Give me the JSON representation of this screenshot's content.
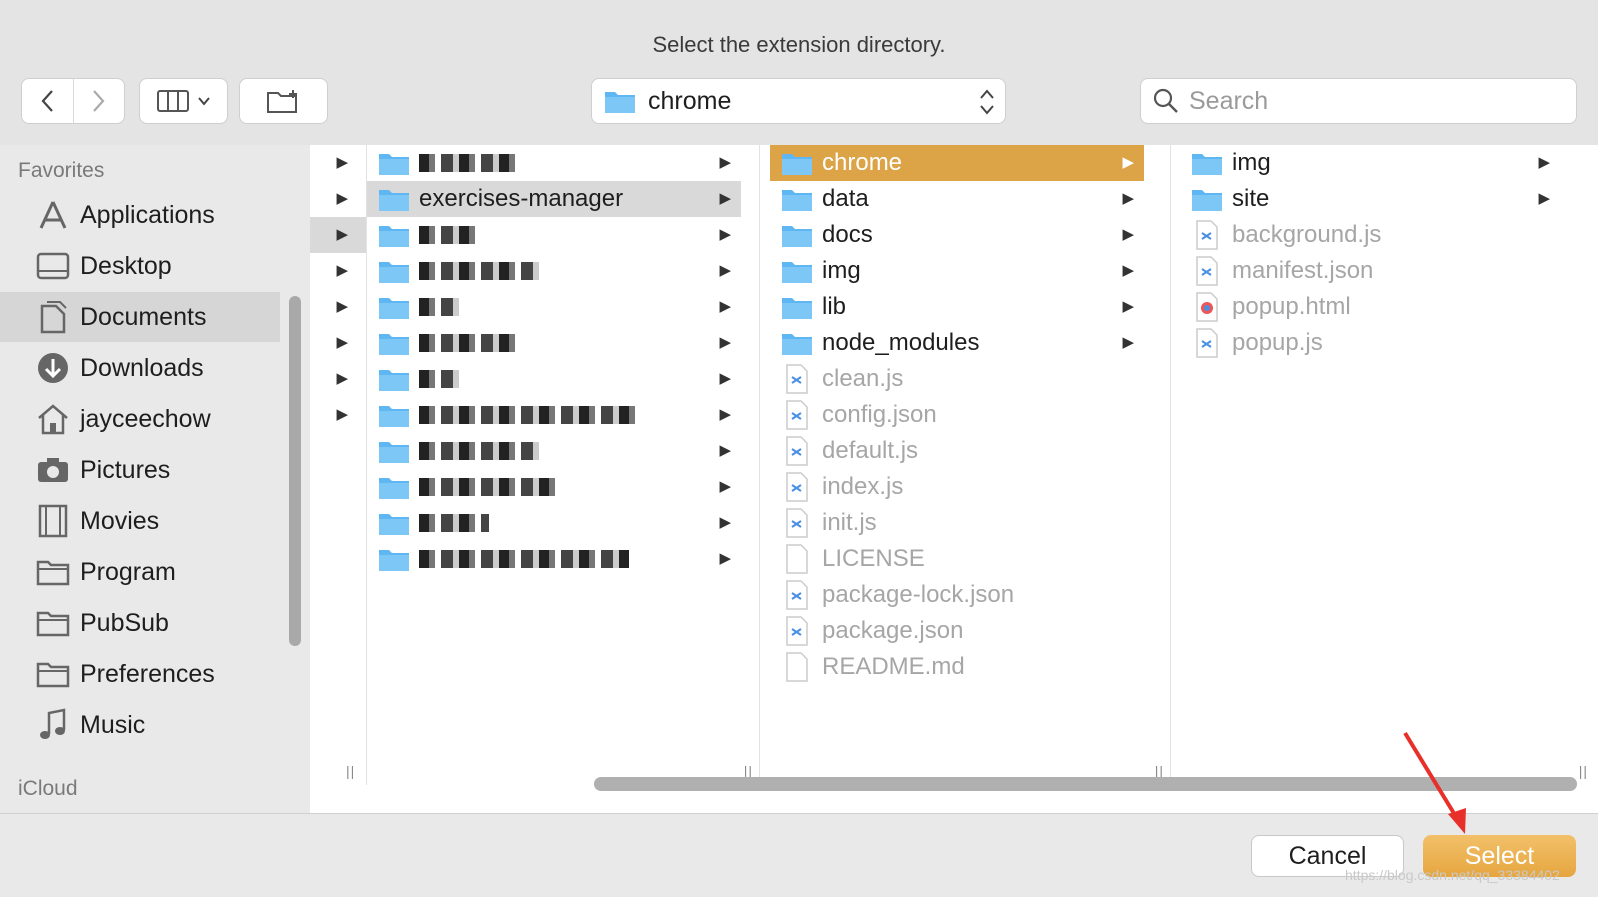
{
  "dialog": {
    "title": "Select the extension directory."
  },
  "toolbar": {
    "path_label": "chrome",
    "search_placeholder": "Search"
  },
  "sidebar": {
    "favorites_header": "Favorites",
    "icloud_header": "iCloud",
    "items": [
      {
        "label": "Applications",
        "icon": "applications-icon"
      },
      {
        "label": "Desktop",
        "icon": "desktop-icon"
      },
      {
        "label": "Documents",
        "icon": "documents-icon",
        "selected": true
      },
      {
        "label": "Downloads",
        "icon": "downloads-icon"
      },
      {
        "label": "jayceechow",
        "icon": "home-icon"
      },
      {
        "label": "Pictures",
        "icon": "camera-icon"
      },
      {
        "label": "Movies",
        "icon": "film-icon"
      },
      {
        "label": "Program",
        "icon": "folder-icon"
      },
      {
        "label": "PubSub",
        "icon": "folder-icon"
      },
      {
        "label": "Preferences",
        "icon": "folder-icon"
      },
      {
        "label": "Music",
        "icon": "music-icon"
      }
    ]
  },
  "columns": {
    "col1": {
      "visible_name": "exercises-manager"
    },
    "col2": {
      "folders": [
        "chrome",
        "data",
        "docs",
        "img",
        "lib",
        "node_modules"
      ],
      "files": [
        "clean.js",
        "config.json",
        "default.js",
        "index.js",
        "init.js",
        "LICENSE",
        "package-lock.json",
        "package.json",
        "README.md"
      ]
    },
    "col3": {
      "folders": [
        "img",
        "site"
      ],
      "files": [
        "background.js",
        "manifest.json",
        "popup.html",
        "popup.js"
      ]
    }
  },
  "buttons": {
    "cancel": "Cancel",
    "select": "Select"
  },
  "watermark": "https://blog.csdn.net/qq_33384402",
  "colors": {
    "accent": "#dca347",
    "folder": "#5eb7f2"
  }
}
